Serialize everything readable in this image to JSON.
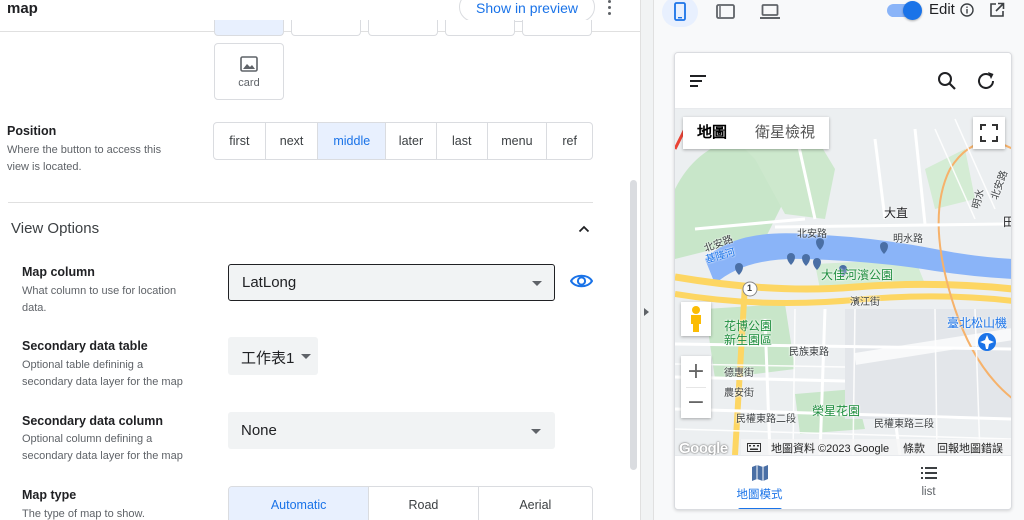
{
  "editor": {
    "view_name": "map",
    "show_in_preview": "Show in preview",
    "card_option": "card",
    "position": {
      "title": "Position",
      "description_line1": "Where the button to access this",
      "description_line2": "view is located.",
      "options": [
        "first",
        "next",
        "middle",
        "later",
        "last",
        "menu",
        "ref"
      ],
      "selected": "middle"
    },
    "view_options": {
      "title": "View Options",
      "map_column": {
        "title": "Map column",
        "description_line1": "What column to use for location",
        "description_line2": "data.",
        "value": "LatLong"
      },
      "secondary_table": {
        "title": "Secondary data table",
        "description_line1": "Optional table defininig a",
        "description_line2": "secondary data layer for the map",
        "value": "工作表1"
      },
      "secondary_column": {
        "title": "Secondary data column",
        "description_line1": "Optional column defining a",
        "description_line2": "secondary data layer for the map",
        "value": "None"
      },
      "map_type": {
        "title": "Map type",
        "description_line1": "The type of map to show.",
        "options": [
          "Automatic",
          "Road",
          "Aerial"
        ],
        "selected": "Automatic"
      }
    }
  },
  "preview": {
    "edit_label": "Edit",
    "device_selected": "phone",
    "edit_toggle_on": true,
    "map": {
      "type_tabs": [
        "地圖",
        "衛星檢視"
      ],
      "type_selected": "地圖",
      "labels": {
        "dazhi": "大直",
        "beian_rd_1": "北安路",
        "beian_rd_2": "北安路",
        "beian_rd_3": "北安路",
        "mingshui_rd": "明水路",
        "mingshui_v": "明水",
        "keelung_river": "基隆河",
        "riverside_park": "大佳河濱公園",
        "binjiang_st": "濱江街",
        "flora_park_1": "花博公園",
        "flora_park_2": "新生園區",
        "minzu_e_rd": "民族東路",
        "deshui_st": "德惠街",
        "nongan_st": "農安街",
        "minquan_e_rd_2": "民權東路二段",
        "minquan_e_rd_3": "民權東路三段",
        "rongxing_garden": "榮星花園",
        "songshan_airport": "臺北松山機",
        "tian": "田",
        "route": "1"
      },
      "attribution": {
        "logo": "Google",
        "data": "地圖資料 ©2023 Google",
        "terms": "條款",
        "report": "回報地圖錯誤"
      }
    },
    "nav": [
      {
        "label": "地圖模式",
        "icon": "map-icon",
        "selected": true
      },
      {
        "label": "list",
        "icon": "list-icon",
        "selected": false
      }
    ]
  },
  "colors": {
    "accent": "#1a73e8",
    "park": "#c8e6c9",
    "water": "#8ab4f8",
    "highway": "#fdd663"
  }
}
